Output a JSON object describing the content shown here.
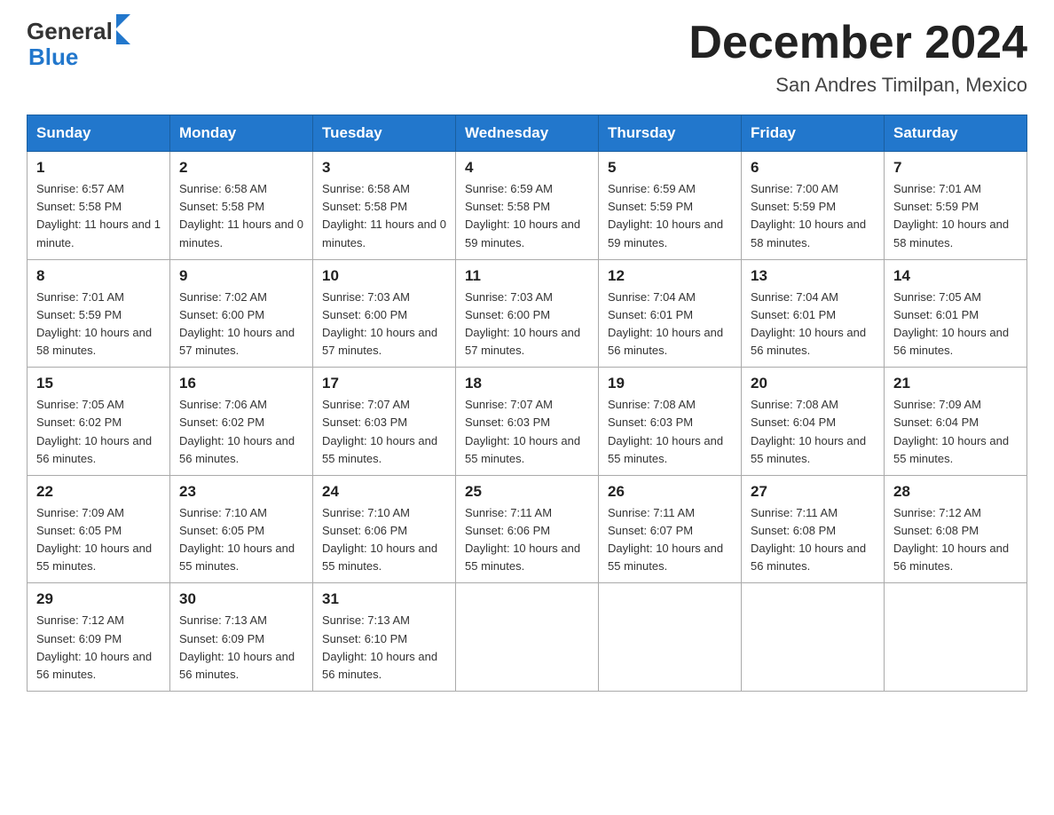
{
  "header": {
    "logo_general": "General",
    "logo_blue": "Blue",
    "title": "December 2024",
    "subtitle": "San Andres Timilpan, Mexico"
  },
  "days_of_week": [
    "Sunday",
    "Monday",
    "Tuesday",
    "Wednesday",
    "Thursday",
    "Friday",
    "Saturday"
  ],
  "weeks": [
    [
      {
        "day": "1",
        "sunrise": "6:57 AM",
        "sunset": "5:58 PM",
        "daylight": "11 hours and 1 minute."
      },
      {
        "day": "2",
        "sunrise": "6:58 AM",
        "sunset": "5:58 PM",
        "daylight": "11 hours and 0 minutes."
      },
      {
        "day": "3",
        "sunrise": "6:58 AM",
        "sunset": "5:58 PM",
        "daylight": "11 hours and 0 minutes."
      },
      {
        "day": "4",
        "sunrise": "6:59 AM",
        "sunset": "5:58 PM",
        "daylight": "10 hours and 59 minutes."
      },
      {
        "day": "5",
        "sunrise": "6:59 AM",
        "sunset": "5:59 PM",
        "daylight": "10 hours and 59 minutes."
      },
      {
        "day": "6",
        "sunrise": "7:00 AM",
        "sunset": "5:59 PM",
        "daylight": "10 hours and 58 minutes."
      },
      {
        "day": "7",
        "sunrise": "7:01 AM",
        "sunset": "5:59 PM",
        "daylight": "10 hours and 58 minutes."
      }
    ],
    [
      {
        "day": "8",
        "sunrise": "7:01 AM",
        "sunset": "5:59 PM",
        "daylight": "10 hours and 58 minutes."
      },
      {
        "day": "9",
        "sunrise": "7:02 AM",
        "sunset": "6:00 PM",
        "daylight": "10 hours and 57 minutes."
      },
      {
        "day": "10",
        "sunrise": "7:03 AM",
        "sunset": "6:00 PM",
        "daylight": "10 hours and 57 minutes."
      },
      {
        "day": "11",
        "sunrise": "7:03 AM",
        "sunset": "6:00 PM",
        "daylight": "10 hours and 57 minutes."
      },
      {
        "day": "12",
        "sunrise": "7:04 AM",
        "sunset": "6:01 PM",
        "daylight": "10 hours and 56 minutes."
      },
      {
        "day": "13",
        "sunrise": "7:04 AM",
        "sunset": "6:01 PM",
        "daylight": "10 hours and 56 minutes."
      },
      {
        "day": "14",
        "sunrise": "7:05 AM",
        "sunset": "6:01 PM",
        "daylight": "10 hours and 56 minutes."
      }
    ],
    [
      {
        "day": "15",
        "sunrise": "7:05 AM",
        "sunset": "6:02 PM",
        "daylight": "10 hours and 56 minutes."
      },
      {
        "day": "16",
        "sunrise": "7:06 AM",
        "sunset": "6:02 PM",
        "daylight": "10 hours and 56 minutes."
      },
      {
        "day": "17",
        "sunrise": "7:07 AM",
        "sunset": "6:03 PM",
        "daylight": "10 hours and 55 minutes."
      },
      {
        "day": "18",
        "sunrise": "7:07 AM",
        "sunset": "6:03 PM",
        "daylight": "10 hours and 55 minutes."
      },
      {
        "day": "19",
        "sunrise": "7:08 AM",
        "sunset": "6:03 PM",
        "daylight": "10 hours and 55 minutes."
      },
      {
        "day": "20",
        "sunrise": "7:08 AM",
        "sunset": "6:04 PM",
        "daylight": "10 hours and 55 minutes."
      },
      {
        "day": "21",
        "sunrise": "7:09 AM",
        "sunset": "6:04 PM",
        "daylight": "10 hours and 55 minutes."
      }
    ],
    [
      {
        "day": "22",
        "sunrise": "7:09 AM",
        "sunset": "6:05 PM",
        "daylight": "10 hours and 55 minutes."
      },
      {
        "day": "23",
        "sunrise": "7:10 AM",
        "sunset": "6:05 PM",
        "daylight": "10 hours and 55 minutes."
      },
      {
        "day": "24",
        "sunrise": "7:10 AM",
        "sunset": "6:06 PM",
        "daylight": "10 hours and 55 minutes."
      },
      {
        "day": "25",
        "sunrise": "7:11 AM",
        "sunset": "6:06 PM",
        "daylight": "10 hours and 55 minutes."
      },
      {
        "day": "26",
        "sunrise": "7:11 AM",
        "sunset": "6:07 PM",
        "daylight": "10 hours and 55 minutes."
      },
      {
        "day": "27",
        "sunrise": "7:11 AM",
        "sunset": "6:08 PM",
        "daylight": "10 hours and 56 minutes."
      },
      {
        "day": "28",
        "sunrise": "7:12 AM",
        "sunset": "6:08 PM",
        "daylight": "10 hours and 56 minutes."
      }
    ],
    [
      {
        "day": "29",
        "sunrise": "7:12 AM",
        "sunset": "6:09 PM",
        "daylight": "10 hours and 56 minutes."
      },
      {
        "day": "30",
        "sunrise": "7:13 AM",
        "sunset": "6:09 PM",
        "daylight": "10 hours and 56 minutes."
      },
      {
        "day": "31",
        "sunrise": "7:13 AM",
        "sunset": "6:10 PM",
        "daylight": "10 hours and 56 minutes."
      },
      null,
      null,
      null,
      null
    ]
  ]
}
